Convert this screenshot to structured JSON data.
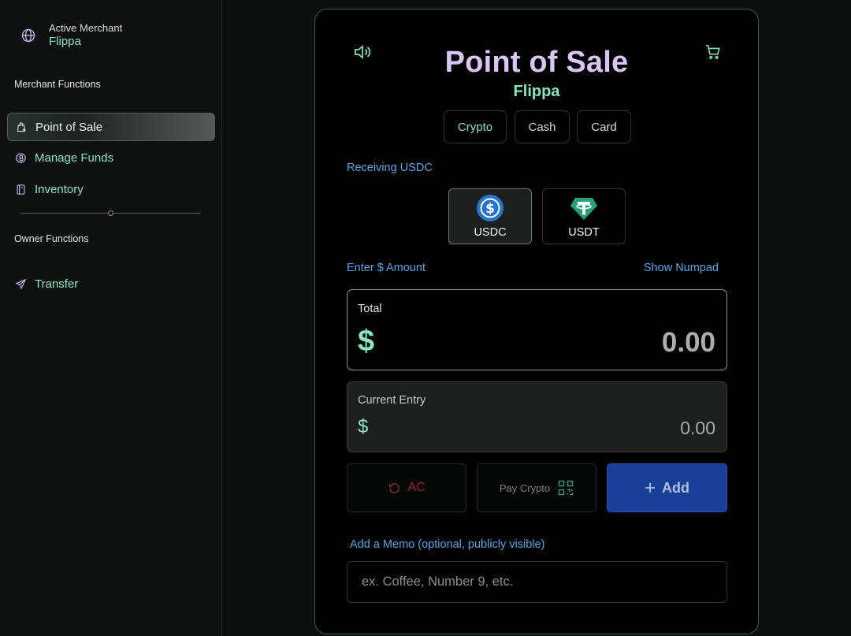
{
  "sidebar": {
    "merchant_label": "Active Merchant",
    "merchant_name": "Flippa",
    "merchant_section": "Merchant Functions",
    "owner_section": "Owner Functions",
    "items": [
      {
        "label": "Point of Sale",
        "icon": "pos-bag-icon"
      },
      {
        "label": "Manage Funds",
        "icon": "coin-icon"
      },
      {
        "label": "Inventory",
        "icon": "book-icon"
      }
    ],
    "owner_items": [
      {
        "label": "Transfer",
        "icon": "send-icon"
      }
    ]
  },
  "pos": {
    "title": "Point of Sale",
    "merchant": "Flippa",
    "tabs": [
      "Crypto",
      "Cash",
      "Card"
    ],
    "active_tab": "Crypto",
    "receiving": "Receiving USDC",
    "tokens": [
      "USDC",
      "USDT"
    ],
    "selected_token": "USDC",
    "enter_amount": "Enter $ Amount",
    "show_numpad": "Show Numpad",
    "total_label": "Total",
    "currency": "$",
    "total": "0.00",
    "entry_label": "Current Entry",
    "entry": "0.00",
    "ac_label": "AC",
    "pay_label": "Pay Crypto",
    "add_label": "Add",
    "memo_label": "Add a Memo (optional, publicly visible)",
    "memo_placeholder": "ex. Coffee, Number 9, etc."
  },
  "colors": {
    "accent_green": "#86e6c0",
    "title_purple": "#d9c6f5",
    "link_blue": "#4fa8e6",
    "add_blue": "#1a3f99",
    "ac_red": "#8c2b2b"
  }
}
